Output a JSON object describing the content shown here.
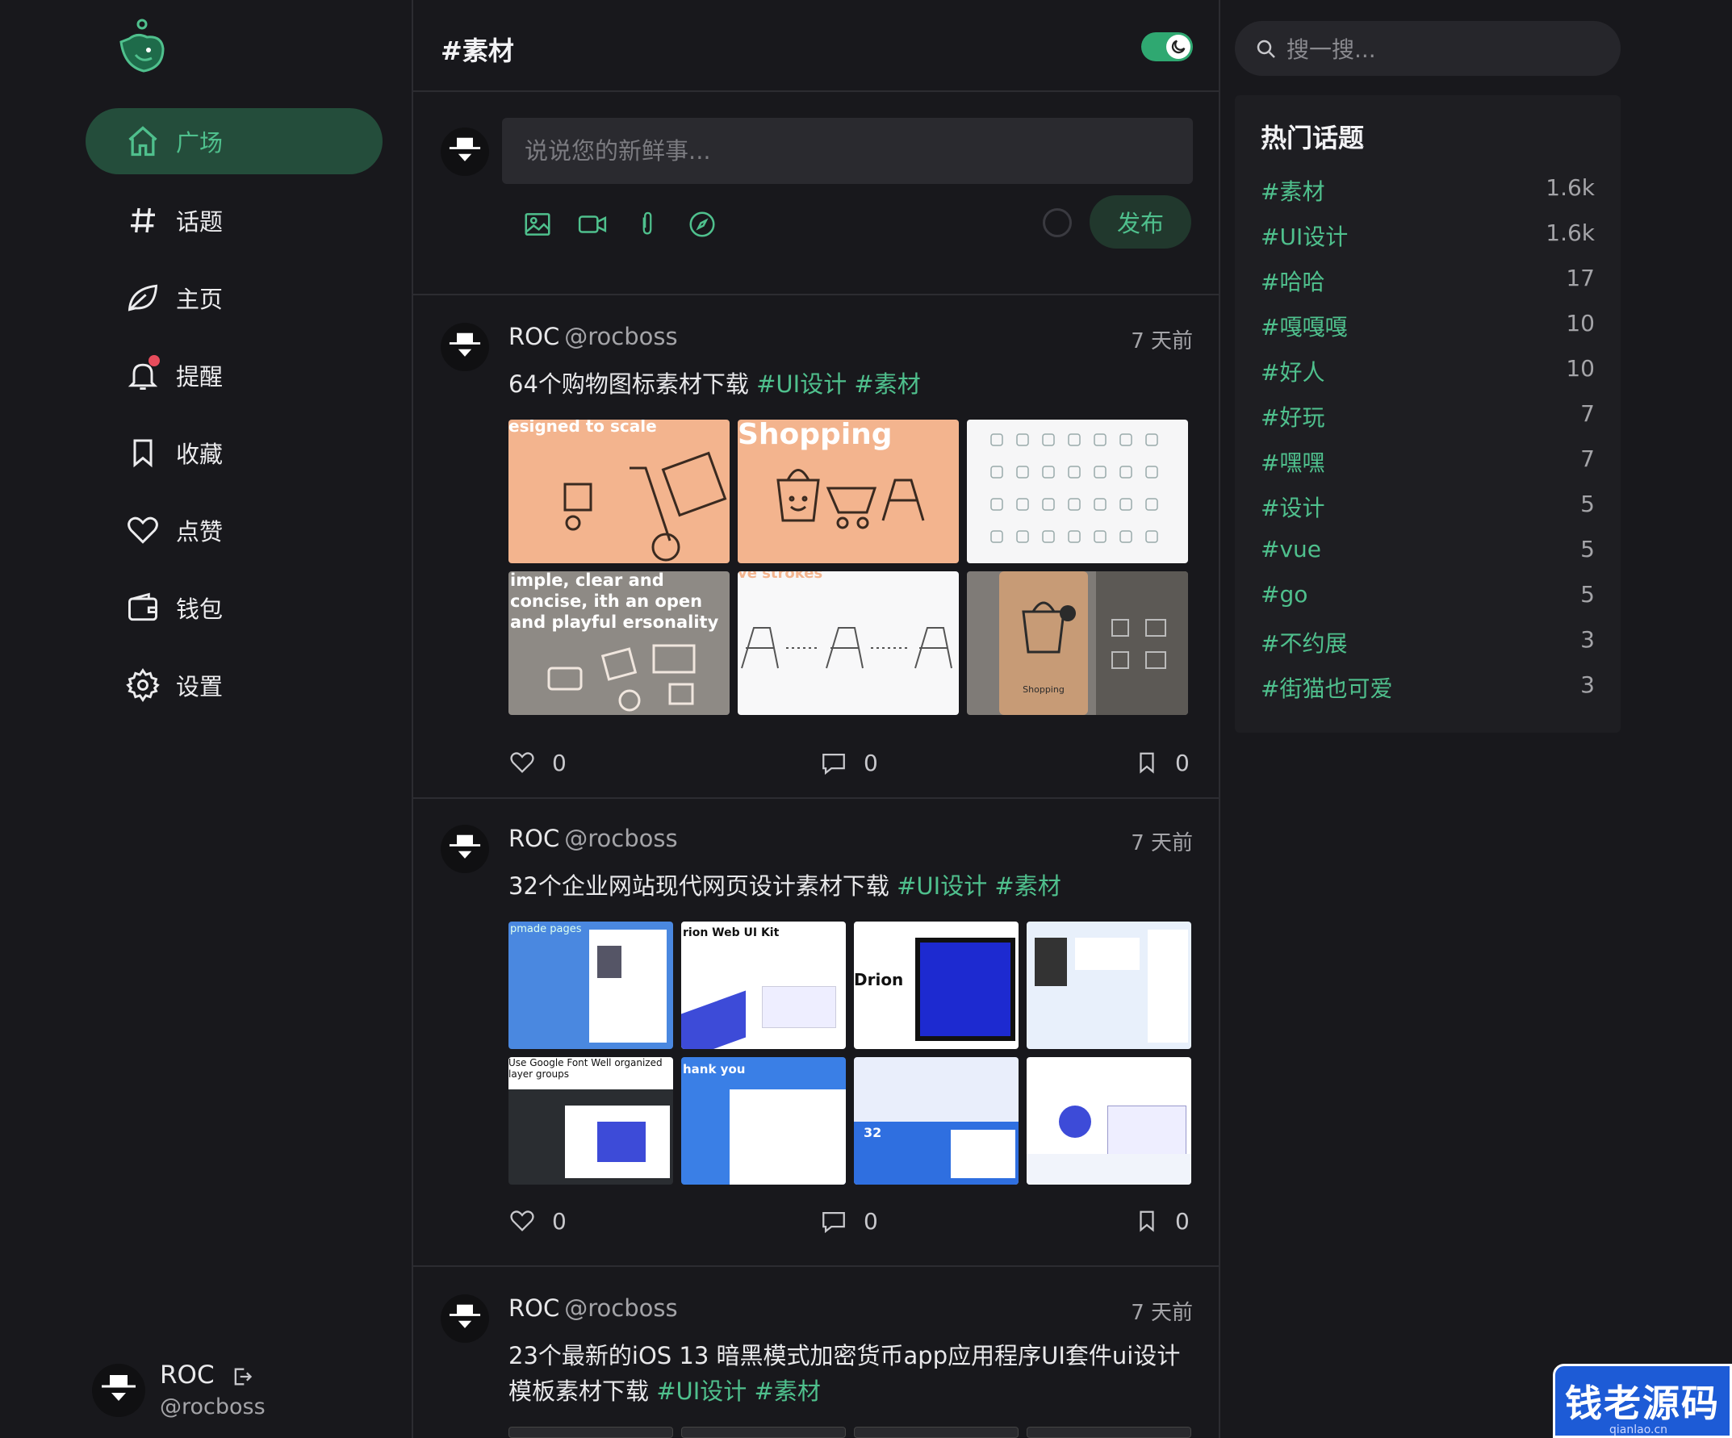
{
  "sidebar": {
    "items": [
      {
        "label": "广场",
        "icon": "home-icon"
      },
      {
        "label": "话题",
        "icon": "hash-icon"
      },
      {
        "label": "主页",
        "icon": "leaf-icon"
      },
      {
        "label": "提醒",
        "icon": "bell-icon"
      },
      {
        "label": "收藏",
        "icon": "bookmark-icon"
      },
      {
        "label": "点赞",
        "icon": "heart-icon"
      },
      {
        "label": "钱包",
        "icon": "wallet-icon"
      },
      {
        "label": "设置",
        "icon": "gear-icon"
      }
    ],
    "user": {
      "name": "ROC",
      "handle": "@rocboss"
    }
  },
  "header": {
    "title": "#素材",
    "dark_mode": true
  },
  "composer": {
    "placeholder": "说说您的新鲜事...",
    "publish_label": "发布"
  },
  "posts": [
    {
      "author": "ROC",
      "handle": "@rocboss",
      "time": "7 天前",
      "text": "64个购物图标素材下载",
      "tags": [
        "#UI设计",
        "#素材"
      ],
      "likes": "0",
      "comments": "0",
      "collections": "0",
      "images": [
        "esigned to scale",
        "Shopping",
        "",
        "imple, clear and concise, ith an open and playful ersonality",
        "ve strokes",
        "Shopping"
      ]
    },
    {
      "author": "ROC",
      "handle": "@rocboss",
      "time": "7 天前",
      "text": "32个企业网站现代网页设计素材下载",
      "tags": [
        "#UI设计",
        "#素材"
      ],
      "likes": "0",
      "comments": "0",
      "collections": "0",
      "images": [
        "pmade pages",
        "rion Web UI Kit",
        "Drion",
        "",
        "Use Google Font Well organized layer groups",
        "hank you",
        "32",
        ""
      ]
    },
    {
      "author": "ROC",
      "handle": "@rocboss",
      "time": "7 天前",
      "text": "23个最新的iOS 13 暗黑模式加密货币app应用程序UI套件ui设计模板素材下载",
      "tags": [
        "#UI设计",
        "#素材"
      ]
    }
  ],
  "search": {
    "placeholder": "搜一搜..."
  },
  "hot_topics": {
    "title": "热门话题",
    "items": [
      {
        "name": "#素材",
        "count": "1.6k"
      },
      {
        "name": "#UI设计",
        "count": "1.6k"
      },
      {
        "name": "#哈哈",
        "count": "17"
      },
      {
        "name": "#嘎嘎嘎",
        "count": "10"
      },
      {
        "name": "#好人",
        "count": "10"
      },
      {
        "name": "#好玩",
        "count": "7"
      },
      {
        "name": "#嘿嘿",
        "count": "7"
      },
      {
        "name": "#设计",
        "count": "5"
      },
      {
        "name": "#vue",
        "count": "5"
      },
      {
        "name": "#go",
        "count": "5"
      },
      {
        "name": "#不约展",
        "count": "3"
      },
      {
        "name": "#街猫也可爱",
        "count": "3"
      }
    ]
  },
  "watermark": {
    "text": "钱老源码",
    "sub": "qianlao.cn"
  },
  "colors": {
    "accent": "#4fc08d",
    "background": "#18181c",
    "active_nav": "#244d3b",
    "badge": "#e74c5c"
  }
}
